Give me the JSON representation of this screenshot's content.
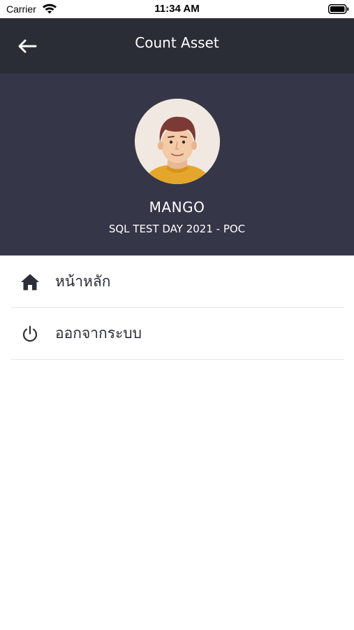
{
  "status_bar": {
    "carrier": "Carrier",
    "time": "11:34 AM",
    "wifi_icon": "wifi-icon",
    "battery_icon": "battery-icon"
  },
  "nav": {
    "title": "Count Asset",
    "back_icon": "arrow-left-icon",
    "background": "#2b2d36"
  },
  "profile": {
    "name": "MANGO",
    "subtitle": "SQL TEST DAY 2021 - POC",
    "avatar_icon": "avatar",
    "background": "#353748"
  },
  "menu": {
    "items": [
      {
        "label": "หน้าหลัก",
        "icon": "home-icon"
      },
      {
        "label": "ออกจากระบบ",
        "icon": "power-icon"
      }
    ]
  }
}
